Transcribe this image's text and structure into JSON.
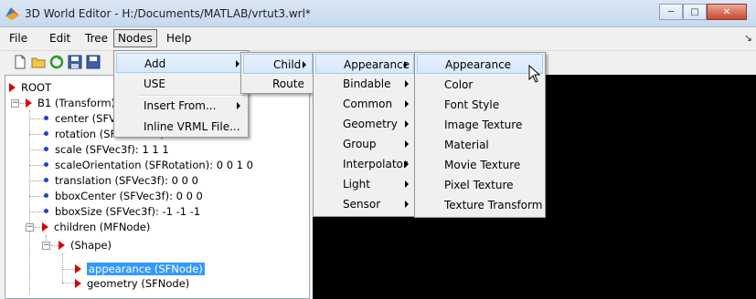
{
  "window": {
    "title": "3D World Editor - H:/Documents/MATLAB/vrtut3.wrl*"
  },
  "menubar": [
    "File",
    "Edit",
    "Tree",
    "Nodes",
    "Help"
  ],
  "tree": {
    "root": "ROOT",
    "b1": "B1 (Transform)",
    "fields": [
      "center (SFVec3f): 0 0 0",
      "rotation (SFRotation): 0 0 1 0",
      "scale (SFVec3f): 1 1 1",
      "scaleOrientation (SFRotation): 0 0 1 0",
      "translation (SFVec3f): 0 0 0",
      "bboxCenter (SFVec3f): 0 0 0",
      "bboxSize (SFVec3f): -1 -1 -1"
    ],
    "children": "children (MFNode)",
    "shape": "(Shape)",
    "appearance": "appearance (SFNode)",
    "geometry": "geometry (SFNode)"
  },
  "nodes_menu": {
    "add": "Add",
    "use": "USE",
    "insert_from": "Insert From...",
    "inline": "Inline VRML File..."
  },
  "add_menu": {
    "child": "Child",
    "route": "Route"
  },
  "child_menu": [
    "Appearance",
    "Bindable",
    "Common",
    "Geometry",
    "Group",
    "Interpolator",
    "Light",
    "Sensor"
  ],
  "appearance_menu": [
    "Appearance",
    "Color",
    "Font Style",
    "Image Texture",
    "Material",
    "Movie Texture",
    "Pixel Texture",
    "Texture Transform"
  ]
}
